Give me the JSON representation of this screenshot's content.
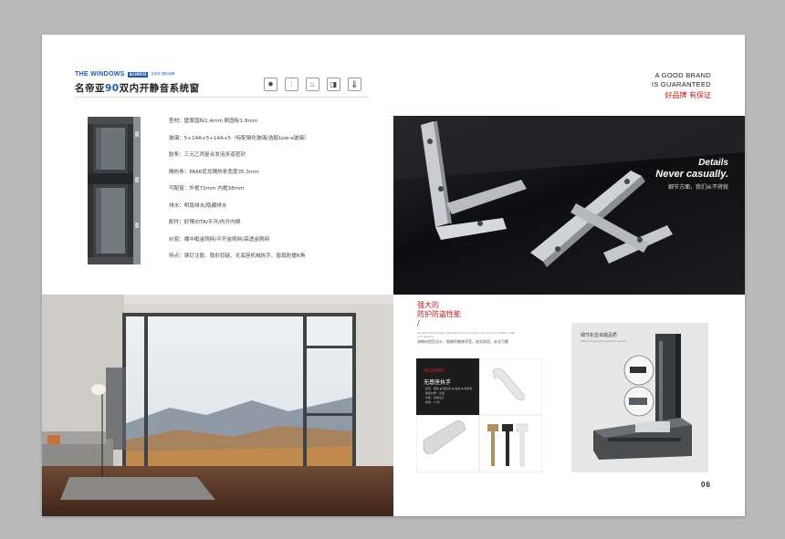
{
  "header": {
    "brand_en": "THE WINDOWS",
    "logo_mark": "SCHÜCO",
    "logo_text": "名帝亚 国际品牌",
    "title_prefix": "名帝亚",
    "title_highlight": "90",
    "title_suffix": "双内开静音系统窗"
  },
  "feature_icons": [
    {
      "icon": "sun-icon",
      "glyph": "✹"
    },
    {
      "icon": "adjust-icon",
      "glyph": "⫶"
    },
    {
      "icon": "fire-icon",
      "glyph": "♨"
    },
    {
      "icon": "window-icon",
      "glyph": "◨"
    },
    {
      "icon": "thermometer-icon",
      "glyph": "🌡"
    }
  ],
  "guarantee": {
    "line1": "A GOOD BRAND",
    "line2": "IS GUARANTEED",
    "cn": "好品牌 有保证"
  },
  "specs": [
    "型材：壁厚国标1.4mm    断国标1.8mm",
    "玻璃：5+14A+5+14A+5（标配钢化玻璃/选配Low-e玻璃）",
    "胶条：三元乙丙复合发泡多道密封",
    "隔热条：PA66尼龙隔热条宽度35.3mm",
    "可配窗：外框72mm    内框38mm",
    "排水：明扇排水/隐藏排水",
    "配件：好博/DTA/平开/内开内倒",
    "纱窗：横中梃金刚网/平开金刚网/高透金刚网",
    "特点：铆钉注胶、隐形铰链、无底座机械执手、窗扇防撞R角"
  ],
  "hinge_photo": {
    "line1": "Details",
    "line2": "Never casually.",
    "line3": "细节方面，我们从不将就"
  },
  "antitheft": {
    "title_line1": "强大的",
    "title_line2": "防护防盗性能",
    "title_line3": "/",
    "en_text": "Smooth new design, desirable touch function, strong and durable, safe and reliable",
    "desc": "流畅的造型设计，细腻的触感享受，结实耐用，安全可靠"
  },
  "handle_panel": {
    "code": "HJ-2400C",
    "title": "无基座执手",
    "lines": [
      "· 颜色：黑色 ◆ 银白色 ◆ 金色 ◆ 香槟色",
      "· 面板材质：合金",
      "· 功能：防撞设计",
      "· 质量：15年"
    ]
  },
  "cross_section": {
    "title": "细节彰显卓越品质",
    "en": "Details highlight excellent quality"
  },
  "page_number": "06"
}
